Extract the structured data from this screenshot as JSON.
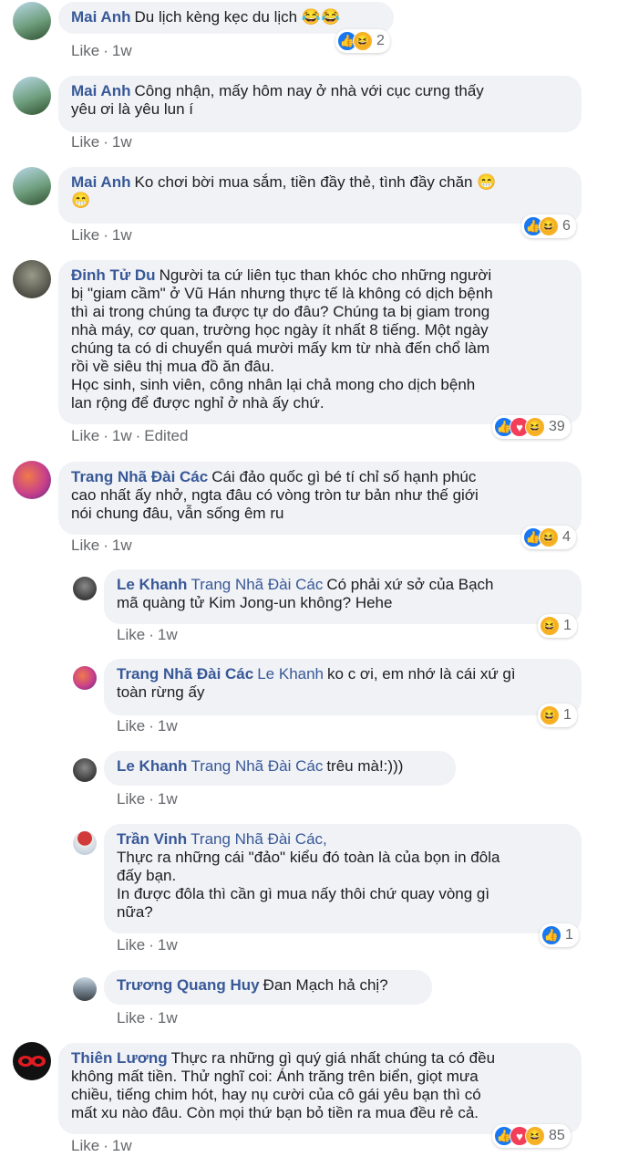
{
  "comments": [
    {
      "name": "Mai Anh",
      "text": "Du lịch kèng kẹc du lịch 😂😂",
      "like": "Like",
      "time": "1w",
      "reactions": {
        "icons": [
          "like",
          "haha"
        ],
        "count": "2"
      }
    },
    {
      "name": "Mai Anh",
      "text": "Công nhận, mấy hôm nay ở nhà với cục cưng thấy\nyêu ơi là yêu lun í",
      "like": "Like",
      "time": "1w"
    },
    {
      "name": "Mai Anh",
      "text": "Ko chơi bời mua sắm, tiền đầy thẻ, tình đầy chăn 😁\n😁",
      "like": "Like",
      "time": "1w",
      "reactions": {
        "icons": [
          "like",
          "haha"
        ],
        "count": "6"
      }
    },
    {
      "name": "Đinh Tử Du",
      "text": "Người ta cứ liên tục than khóc cho những người\nbị \"giam cầm\" ở Vũ Hán nhưng thực tế là không có dịch bệnh\nthì ai trong chúng ta được tự do đâu? Chúng ta bị giam trong\nnhà máy, cơ quan, trường học ngày ít nhất 8 tiếng. Một ngày\nchúng ta có di chuyển quá mười mấy km từ nhà đến chổ làm\nrồi về siêu thị mua đồ ăn đâu.\nHọc sinh, sinh viên, công nhân lại chả mong cho dịch bệnh\nlan rộng để được nghỉ ở nhà ấy chứ.",
      "like": "Like",
      "time": "1w",
      "edited": "Edited",
      "reactions": {
        "icons": [
          "like",
          "love",
          "haha"
        ],
        "count": "39"
      }
    },
    {
      "name": "Trang Nhã Đài Các",
      "text": "Cái đảo quốc gì bé tí chỉ số hạnh phúc\ncao nhất ấy nhở, ngta đâu có vòng tròn tư bản như thế giới\nnói chung đâu, vẫn sống êm ru",
      "like": "Like",
      "time": "1w",
      "reactions": {
        "icons": [
          "like",
          "haha"
        ],
        "count": "4"
      }
    }
  ],
  "replies": [
    {
      "name": "Le Khanh",
      "tag": "Trang Nhã Đài Các",
      "text": "Có phải xứ sở của Bạch\nmã quàng tử Kim Jong-un không? Hehe",
      "like": "Like",
      "time": "1w",
      "reactions": {
        "icons": [
          "haha"
        ],
        "count": "1"
      }
    },
    {
      "name": "Trang Nhã Đài Các",
      "tag": "Le Khanh",
      "text": "ko c ơi, em nhớ là cái xứ gì\ntoàn rừng ấy",
      "like": "Like",
      "time": "1w",
      "reactions": {
        "icons": [
          "haha"
        ],
        "count": "1"
      }
    },
    {
      "name": "Le Khanh",
      "tag": "Trang Nhã Đài Các",
      "text": "trêu mà!:)))",
      "like": "Like",
      "time": "1w"
    },
    {
      "name": "Trần Vinh",
      "tag": "Trang Nhã Đài Các,",
      "text": "\nThực ra những cái \"đảo\" kiểu đó toàn là của bọn in đôla\nđấy bạn.\nIn được đôla thì cần gì mua nấy thôi chứ quay vòng gì\nnữa?",
      "like": "Like",
      "time": "1w",
      "reactions": {
        "icons": [
          "like"
        ],
        "count": "1"
      }
    },
    {
      "name": "Trương Quang Huy",
      "tag": "",
      "text": "Đan Mạch hả chị?",
      "like": "Like",
      "time": "1w"
    }
  ],
  "last": {
    "name": "Thiên Lương",
    "text": "Thực ra những gì quý giá nhất chúng ta có đều\nkhông mất tiền. Thử nghĩ coi: Ánh trăng trên biển, giọt mưa\nchiều, tiếng chim hót, hay nụ cười của cô gái yêu bạn thì có\nmất xu nào đâu. Còn mọi thứ bạn bỏ tiền ra mua đều rẻ cả.",
    "like": "Like",
    "time": "1w",
    "reactions": {
      "icons": [
        "like",
        "love",
        "haha"
      ],
      "count": "85"
    }
  },
  "icon_glyphs": {
    "like": "👍",
    "love": "♥",
    "haha": "😆"
  },
  "colors": {
    "bubble": "#f0f2f5",
    "name": "#385898",
    "meta": "#65676b",
    "like_blue": "#1877f2",
    "love_red": "#f33e58",
    "haha_yellow": "#f7b125"
  }
}
